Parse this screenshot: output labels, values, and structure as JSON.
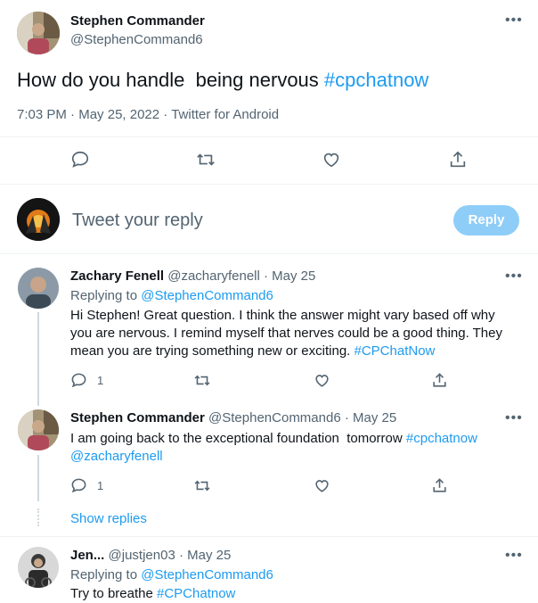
{
  "tweet": {
    "author_name": "Stephen Commander",
    "author_handle": "@StephenCommand6",
    "text": "How do you handle  being nervous ",
    "hashtag": "#cpchatnow",
    "time": "7:03 PM",
    "date": "May 25, 2022",
    "source": "Twitter for Android",
    "sep": "·"
  },
  "reply_box": {
    "placeholder": "Tweet your reply",
    "button": "Reply"
  },
  "replies": [
    {
      "name": "Zachary Fenell",
      "handle": "@zacharyfenell",
      "date": "May 25",
      "replying_to_label": "Replying to ",
      "replying_to_handle": "@StephenCommand6",
      "line1": "Hi Stephen! Great question. I think the answer might vary based off why",
      "line2": "you are nervous. I remind myself that nerves could be a good thing. They",
      "line3": "mean you are trying something new or exciting. ",
      "hashtag": "#CPChatNow",
      "reply_count": "1"
    },
    {
      "name": "Stephen Commander",
      "handle": "@StephenCommand6",
      "date": "May 25",
      "line1": "I am going back to the exceptional foundation  tomorrow ",
      "hashtag": "#cpchatnow",
      "mention": "@zacharyfenell",
      "reply_count": "1"
    },
    {
      "name": "Jen...",
      "handle": "@justjen03",
      "date": "May 25",
      "replying_to_label": "Replying to ",
      "replying_to_handle": "@StephenCommand6",
      "line1": "Try to breathe ",
      "hashtag": "#CPChatnow"
    }
  ],
  "show_replies": "Show replies",
  "icons": {
    "reply": "speech-bubble-icon",
    "retweet": "retweet-icon",
    "like": "heart-icon",
    "share": "share-icon",
    "more": "more-dots-icon"
  },
  "colors": {
    "accent": "#1d9bf0",
    "reply_button_disabled": "#8ecdf8",
    "secondary_text": "#536471",
    "divider": "#eff3f4"
  }
}
